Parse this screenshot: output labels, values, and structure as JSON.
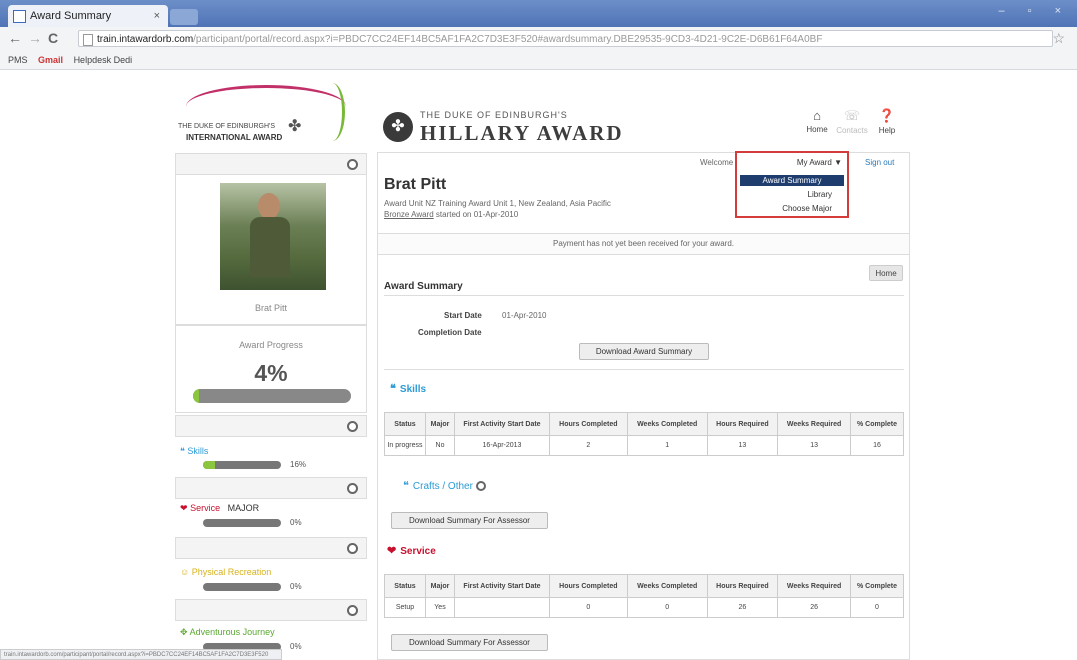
{
  "browser": {
    "tab_title": "Award Summary",
    "tab_close": "×",
    "window_controls": "– ▫ ×",
    "nav_back": "←",
    "nav_forward": "→",
    "nav_reload": "C",
    "url_host": "train.intawardorb.com",
    "url_path": "/participant/portal/record.aspx?i=PBDC7CC24EF14BC5AF1FA2C7D3E3F520#awardsummary.DBE29535-9CD3-4D21-9C2E-D6B61F64A0BF",
    "bookmark_pms": "PMS",
    "bookmark_gmail": "Gmail",
    "bookmark_helpdesk": "Helpdesk Dedi",
    "status_url": "train.intawardorb.com/participant/portal/record.aspx?i=PBDC7CC24EF14BC5AF1FA2C7D3E3F520"
  },
  "header": {
    "left_logo_line1": "THE DUKE OF EDINBURGH'S",
    "left_logo_line2": "INTERNATIONAL AWARD",
    "right_logo_small": "THE DUKE OF EDINBURGH'S",
    "right_logo_big": "HILLARY AWARD",
    "nav_home": "Home",
    "nav_contacts": "Contacts",
    "nav_help": "Help"
  },
  "sidebar": {
    "profile_name": "Brat Pitt",
    "progress_label": "Award Progress",
    "progress_pct_text": "4%",
    "progress_value": 0.04,
    "sections": [
      {
        "label": "Skills",
        "pct_text": "16%",
        "value": 0.16,
        "color": "#2b9bd6"
      },
      {
        "label": "Service",
        "tag": "MAJOR",
        "pct_text": "0%",
        "value": 0.0,
        "color": "#c8102e"
      },
      {
        "label": "Physical Recreation",
        "pct_text": "0%",
        "value": 0.0,
        "color": "#d7b21c"
      },
      {
        "label": "Adventurous Journey",
        "pct_text": "0%",
        "value": 0.0,
        "color": "#5aa832"
      }
    ]
  },
  "main": {
    "welcome": "Welcome Brat",
    "my_award": "My Award ▼",
    "menu_items": [
      "Award Summary",
      "Library",
      "Choose Major"
    ],
    "sign_out": "Sign out",
    "name": "Brat Pitt",
    "subtitle": "Award Unit NZ Training Award Unit 1, New Zealand, Asia Pacific",
    "level_link": "Bronze Award",
    "started": "started on 01-Apr-2010",
    "payment_notice": "Payment has not yet been received for your award.",
    "home_button": "Home",
    "award_summary_title": "Award Summary",
    "start_date_label": "Start Date",
    "start_date_value": "01-Apr-2010",
    "completion_label": "Completion Date",
    "download_summary": "Download Award Summary",
    "skills_label": "Skills",
    "crafts_label": "Crafts / Other",
    "service_label": "Service",
    "download_assessor": "Download Summary For Assessor",
    "table_headers": [
      "Status",
      "Major",
      "First Activity Start Date",
      "Hours Completed",
      "Weeks Completed",
      "Hours Required",
      "Weeks Required",
      "% Complete"
    ],
    "skills_row": [
      "In progress",
      "No",
      "16-Apr-2013",
      "2",
      "1",
      "13",
      "13",
      "16"
    ],
    "service_row": [
      "Setup",
      "Yes",
      "",
      "0",
      "0",
      "26",
      "26",
      "0"
    ]
  },
  "colors": {
    "accent_blue": "#2b7bb9",
    "progress_green": "#8cc63e",
    "highlight_red": "#d43c3c",
    "menu_selected": "#1e3d6e"
  }
}
